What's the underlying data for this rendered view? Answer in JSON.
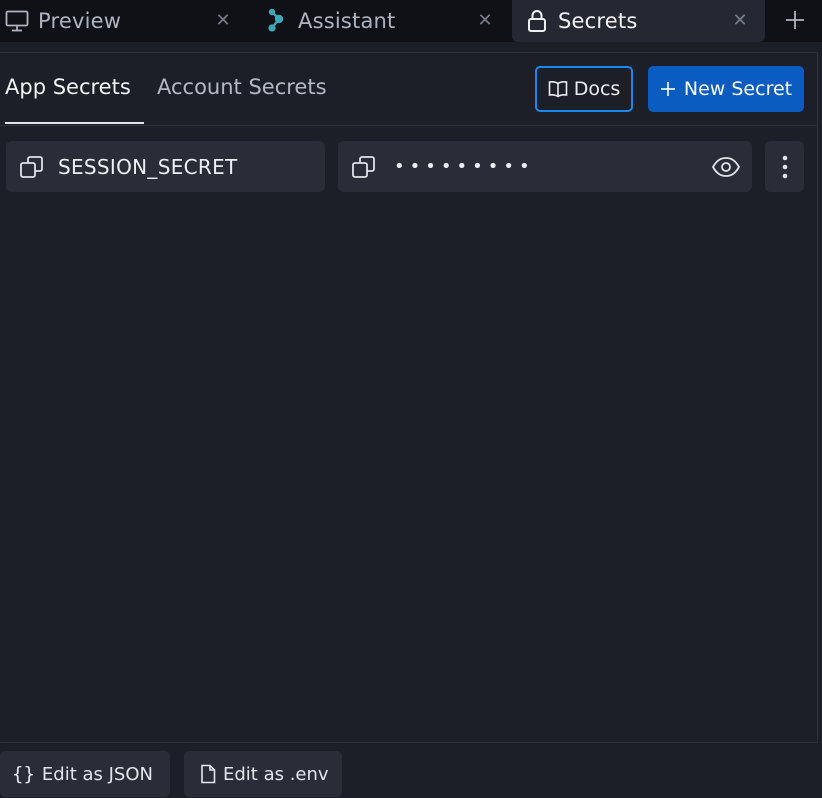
{
  "tabs": [
    {
      "label": "Preview",
      "icon": "monitor-icon"
    },
    {
      "label": "Assistant",
      "icon": "assistant-logo-icon"
    },
    {
      "label": "Secrets",
      "icon": "lock-icon"
    }
  ],
  "active_tab": "Secrets",
  "subtabs": {
    "app": "App Secrets",
    "account": "Account Secrets"
  },
  "toolbar": {
    "docs_label": "Docs",
    "new_secret_label": "New Secret"
  },
  "secrets": [
    {
      "key": "SESSION_SECRET",
      "value_masked": "•••••••••"
    }
  ],
  "footer": {
    "edit_json_icon": "{}",
    "edit_json_label": "Edit as JSON",
    "edit_env_label": "Edit as .env"
  },
  "colors": {
    "background": "#1c1f28",
    "tabbar": "#0f1117",
    "field": "#2a2d37",
    "accent": "#0b5cc1",
    "focus_ring": "#1a86f0",
    "assistant_logo": "#3fa7b5"
  }
}
